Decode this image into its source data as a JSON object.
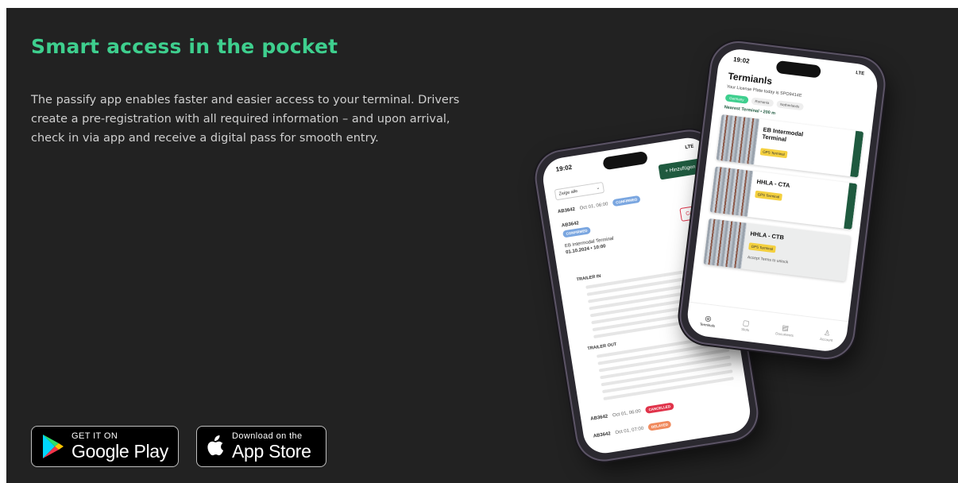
{
  "hero": {
    "headline": "Smart access in the pocket",
    "body": "The passify app enables faster and easier access to your terminal. Drivers create a pre-registration with all required information – and upon arrival, check in via app and receive a digital pass for smooth entry."
  },
  "stores": {
    "google": {
      "small": "GET IT ON",
      "big": "Google Play"
    },
    "apple": {
      "small": "Download on the",
      "big": "App Store"
    }
  },
  "phone_back": {
    "time": "19:02",
    "signal": "LTE",
    "add_button": "+ Hinzufügen",
    "filter": "Zeige alle",
    "rows": [
      {
        "code": "AB3642",
        "date": "Oct 01, 06:00",
        "status": "CONFIRMED"
      },
      {
        "code": "AB3642",
        "date": "Oct 01, 06:00",
        "status": "CANCELLED"
      },
      {
        "code": "AB3642",
        "date": "Oct 01, 07:00",
        "status": "DELAYED"
      }
    ],
    "card": {
      "code": "AB3642",
      "status": "CONFIRMED",
      "cancel": "Cancel",
      "terminal": "EB Intermodal Terminal",
      "datetime": "01.10.2024 • 10:00"
    },
    "sections": [
      "TRAILER IN",
      "TRAILER OUT"
    ]
  },
  "phone_front": {
    "time": "19:02",
    "signal": "LTE",
    "title": "Termianls",
    "subtitle": "Your License Plate today is SPO9414E",
    "tabs": [
      "Germany",
      "Romania",
      "Netherlands"
    ],
    "nearest": "Nearest Terminal • 200 m",
    "cards": [
      {
        "name": "EB Intermodal Terminal",
        "tag": "GPS Terminal"
      },
      {
        "name": "HHLA - CTA",
        "tag": "GPS Terminal"
      },
      {
        "name": "HHLA - CTB",
        "tag": "GPS Terminal",
        "note": "Accept Terms to unlock"
      }
    ],
    "nav": [
      "Terminals",
      "Slots",
      "Documents",
      "Account"
    ]
  }
}
